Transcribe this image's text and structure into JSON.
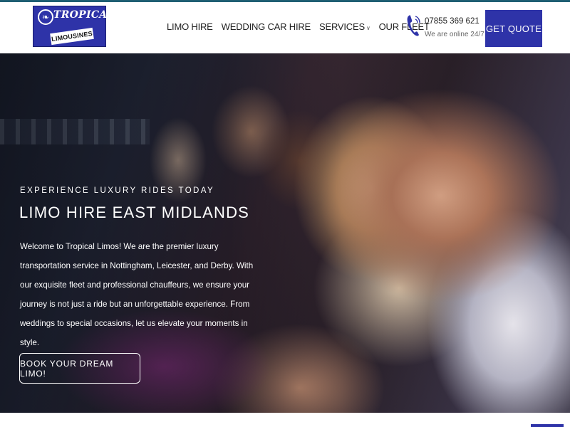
{
  "brand": {
    "name_line1": "TROPICAL",
    "name_line2": "LIMOUSINES",
    "color": "#2e33a8"
  },
  "nav": {
    "items": [
      {
        "label": "LIMO HIRE"
      },
      {
        "label": "WEDDING CAR HIRE"
      },
      {
        "label": "SERVICES"
      },
      {
        "label": "OUR FLEET"
      }
    ]
  },
  "contact": {
    "phone": "07855 369 621",
    "status": "We are online 24/7",
    "icon": "phone-icon"
  },
  "header_cta": {
    "label": "GET QUOTE"
  },
  "hero": {
    "eyebrow": "EXPERIENCE LUXURY RIDES TODAY",
    "title": "LIMO HIRE EAST MIDLANDS",
    "body": "Welcome to Tropical Limos! We are the premier luxury transportation service in Nottingham, Leicester, and Derby. With our exquisite fleet and professional chauffeurs, we ensure your journey is not just a ride but an unforgettable experience. From weddings to special occasions, let us elevate your moments in style.",
    "cta_label": "BOOK YOUR DREAM LIMO!"
  }
}
